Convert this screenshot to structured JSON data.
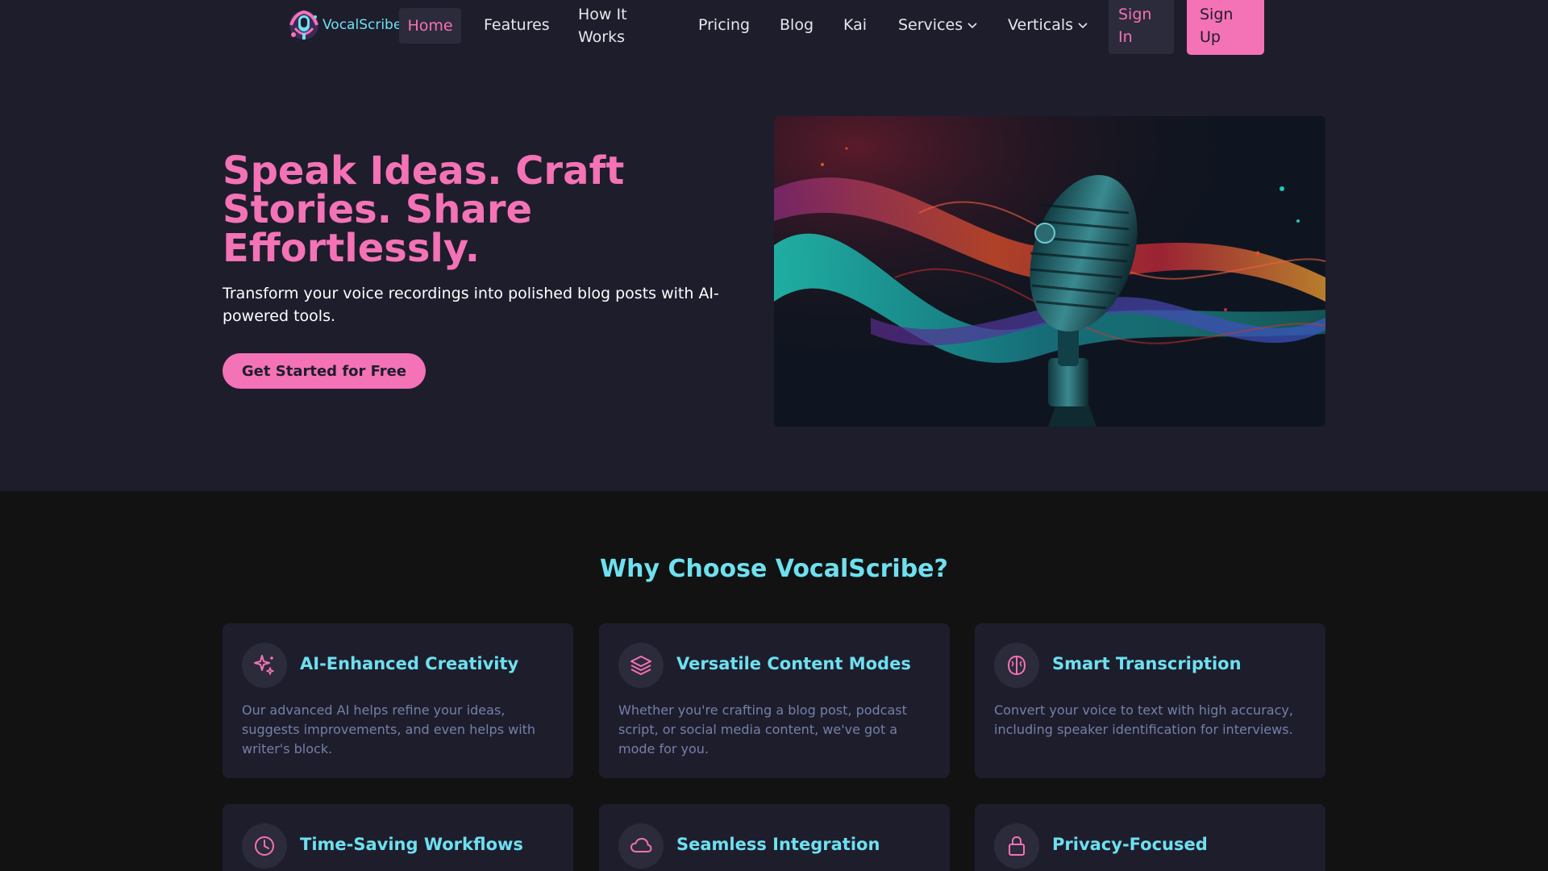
{
  "nav": {
    "brand": "VocalScribe",
    "links": {
      "home": "Home",
      "features": "Features",
      "how_it_works": "How It Works",
      "pricing": "Pricing",
      "blog": "Blog",
      "kai": "Kai",
      "services": "Services",
      "verticals": "Verticals"
    },
    "sign_in": "Sign In",
    "sign_up": "Sign Up"
  },
  "hero": {
    "title": "Speak Ideas. Craft Stories. Share Effortlessly.",
    "subtitle": "Transform your voice recordings into polished blog posts with AI-powered tools.",
    "cta": "Get Started for Free"
  },
  "features": {
    "heading": "Why Choose VocalScribe?",
    "cards": [
      {
        "icon": "sparkles-icon",
        "title": "AI-Enhanced Creativity",
        "text": "Our advanced AI helps refine your ideas, suggests improvements, and even helps with writer's block."
      },
      {
        "icon": "layers-icon",
        "title": "Versatile Content Modes",
        "text": "Whether you're crafting a blog post, podcast script, or social media content, we've got a mode for you."
      },
      {
        "icon": "brain-icon",
        "title": "Smart Transcription",
        "text": "Convert your voice to text with high accuracy, including speaker identification for interviews."
      },
      {
        "icon": "clock-icon",
        "title": "Time-Saving Workflows",
        "text": ""
      },
      {
        "icon": "cloud-icon",
        "title": "Seamless Integration",
        "text": ""
      },
      {
        "icon": "lock-icon",
        "title": "Privacy-Focused",
        "text": ""
      }
    ]
  },
  "colors": {
    "accent_pink": "#f472b6",
    "accent_cyan": "#6ee0f0",
    "nav_bg": "#1e1d2c",
    "page_bg": "#121212"
  }
}
